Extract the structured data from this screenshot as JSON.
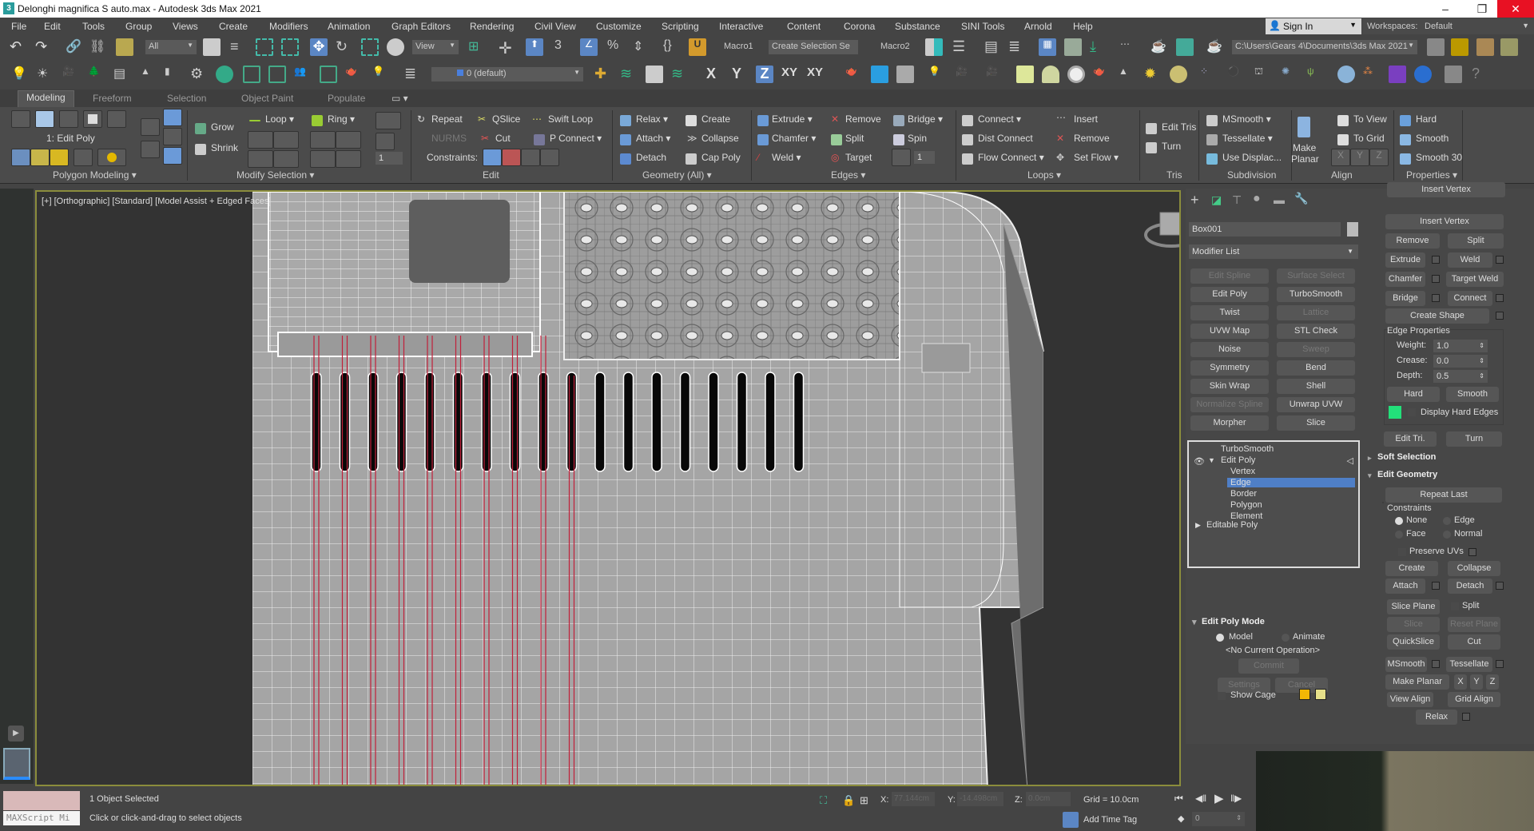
{
  "window": {
    "title": "Delonghi magnifica S auto.max - Autodesk 3ds Max 2021",
    "controls": [
      "minimize",
      "restore",
      "close"
    ]
  },
  "menu": [
    "File",
    "Edit",
    "Tools",
    "Group",
    "Views",
    "Create",
    "Modifiers",
    "Animation",
    "Graph Editors",
    "Rendering",
    "Civil View",
    "Customize",
    "Scripting",
    "Interactive",
    "Content",
    "Corona",
    "Substance",
    "SINI Tools",
    "Arnold",
    "Help"
  ],
  "account": {
    "sign_in": "Sign In",
    "workspaces_label": "Workspaces:",
    "workspace_value": "Default"
  },
  "main_toolbar": {
    "selection_filter": "All",
    "ref_coord": "View",
    "macro1": "Macro1",
    "named_selection": "Create Selection Se",
    "macro2": "Macro2",
    "project_path": "C:\\Users\\Gears 4\\Documents\\3ds Max 2021"
  },
  "layer_toolbar": {
    "layer": "0 (default)",
    "axis": [
      "X",
      "Y",
      "Z",
      "XY",
      "XY"
    ],
    "active_axis": "Z"
  },
  "ribbon_tabs": [
    "Modeling",
    "Freeform",
    "Selection",
    "Object Paint",
    "Populate"
  ],
  "ribbon_active_tab": "Modeling",
  "ribbon": {
    "polygon_modeling": {
      "current": "1: Edit Poly",
      "label": "Polygon Modeling"
    },
    "modify_selection": {
      "grow": "Grow",
      "shrink": "Shrink",
      "loop": "Loop",
      "ring": "Ring",
      "label": "Modify Selection",
      "spinner": "1"
    },
    "edit": {
      "repeat": "Repeat",
      "nurms": "NURMS",
      "qslice": "QSlice",
      "cut": "Cut",
      "swift_loop": "Swift Loop",
      "p_connect": "P Connect",
      "constraints": "Constraints:",
      "label": "Edit"
    },
    "geometry": {
      "relax": "Relax",
      "attach": "Attach",
      "detach": "Detach",
      "create": "Create",
      "collapse": "Collapse",
      "cap_poly": "Cap Poly",
      "label": "Geometry (All)"
    },
    "edges": {
      "extrude": "Extrude",
      "chamfer": "Chamfer",
      "weld": "Weld",
      "remove": "Remove",
      "split": "Split",
      "target": "Target",
      "bridge": "Bridge",
      "spin": "Spin",
      "spinner": "1",
      "label": "Edges"
    },
    "loops": {
      "connect": "Connect",
      "dist_connect": "Dist Connect",
      "flow_connect": "Flow Connect",
      "insert": "Insert",
      "remove": "Remove",
      "set_flow": "Set Flow",
      "label": "Loops"
    },
    "tris": {
      "edit_tris": "Edit Tris",
      "turn": "Turn",
      "label": "Tris"
    },
    "subdivision": {
      "msmooth": "MSmooth",
      "tessellate": "Tessellate",
      "use_displace": "Use Displac...",
      "label": "Subdivision"
    },
    "align": {
      "make_planar_1": "Make",
      "make_planar_2": "Planar",
      "to_view": "To View",
      "to_grid": "To Grid",
      "x": "X",
      "y": "Y",
      "z": "Z",
      "label": "Align"
    },
    "properties": {
      "hard": "Hard",
      "smooth": "Smooth",
      "smooth30": "Smooth 30",
      "label": "Properties"
    }
  },
  "viewport": {
    "label": "[+] [Orthographic] [Standard] [Model Assist + Edged Faces]",
    "slot_count": 18,
    "selected_slots": 10
  },
  "command_panel": {
    "object_name": "Box001",
    "modifier_list": "Modifier List",
    "modifier_buttons": [
      {
        "label": "Edit Spline",
        "enabled": false
      },
      {
        "label": "Surface Select",
        "enabled": false
      },
      {
        "label": "Edit Poly",
        "enabled": true
      },
      {
        "label": "TurboSmooth",
        "enabled": true
      },
      {
        "label": "Twist",
        "enabled": true
      },
      {
        "label": "Lattice",
        "enabled": false
      },
      {
        "label": "UVW Map",
        "enabled": true
      },
      {
        "label": "STL Check",
        "enabled": true
      },
      {
        "label": "Noise",
        "enabled": true
      },
      {
        "label": "Sweep",
        "enabled": false
      },
      {
        "label": "Symmetry",
        "enabled": true
      },
      {
        "label": "Bend",
        "enabled": true
      },
      {
        "label": "Skin Wrap",
        "enabled": true
      },
      {
        "label": "Shell",
        "enabled": true
      },
      {
        "label": "Normalize Spline",
        "enabled": false
      },
      {
        "label": "Unwrap UVW",
        "enabled": true
      },
      {
        "label": "Morpher",
        "enabled": true
      },
      {
        "label": "Slice",
        "enabled": true
      }
    ],
    "stack": {
      "top": "TurboSmooth",
      "edit_poly": "Edit Poly",
      "subobjects": [
        "Vertex",
        "Edge",
        "Border",
        "Polygon",
        "Element"
      ],
      "selected": "Edge",
      "base": "Editable Poly"
    },
    "edit_poly_mode": {
      "title": "Edit Poly Mode",
      "model": "Model",
      "animate": "Animate",
      "operation": "<No Current Operation>",
      "commit": "Commit",
      "settings": "Settings",
      "cancel": "Cancel",
      "show_cage": "Show Cage",
      "cage_colors": [
        "#f2b705",
        "#e6e08a"
      ]
    },
    "edit_edges": {
      "insert_vertex": "Insert Vertex",
      "remove": "Remove",
      "split": "Split",
      "extrude": "Extrude",
      "weld": "Weld",
      "chamfer": "Chamfer",
      "target_weld": "Target Weld",
      "bridge": "Bridge",
      "connect": "Connect",
      "create_shape": "Create Shape",
      "edge_properties": "Edge Properties",
      "weight_label": "Weight:",
      "weight": "1.0",
      "crease_label": "Crease:",
      "crease": "0.0",
      "depth_label": "Depth:",
      "depth": "0.5",
      "hard": "Hard",
      "smooth": "Smooth",
      "hard_edge_color": "#22e07a",
      "display_hard_edges": "Display Hard Edges",
      "edit_tri": "Edit Tri.",
      "turn": "Turn"
    },
    "soft_selection": "Soft Selection",
    "edit_geometry": {
      "title": "Edit Geometry",
      "repeat_last": "Repeat Last",
      "constraints": "Constraints",
      "none": "None",
      "edge": "Edge",
      "face": "Face",
      "normal": "Normal",
      "preserve_uvs": "Preserve UVs",
      "create": "Create",
      "collapse": "Collapse",
      "attach": "Attach",
      "detach": "Detach",
      "slice_plane": "Slice Plane",
      "split": "Split",
      "slice": "Slice",
      "reset_plane": "Reset Plane",
      "quickslice": "QuickSlice",
      "cut": "Cut",
      "msmooth": "MSmooth",
      "tessellate": "Tessellate",
      "make_planar": "Make Planar",
      "x": "X",
      "y": "Y",
      "z": "Z",
      "view_align": "View Align",
      "grid_align": "Grid Align",
      "relax": "Relax"
    }
  },
  "status": {
    "maxscript": "MAXScript Mi",
    "selection": "1 Object Selected",
    "prompt": "Click or click-and-drag to select objects",
    "x_label": "X:",
    "x": "77.144cm",
    "y_label": "Y:",
    "y": "-14.498cm",
    "z_label": "Z:",
    "z": "0.0cm",
    "grid": "Grid = 10.0cm",
    "add_time_tag": "Add Time Tag",
    "frame": "0"
  }
}
